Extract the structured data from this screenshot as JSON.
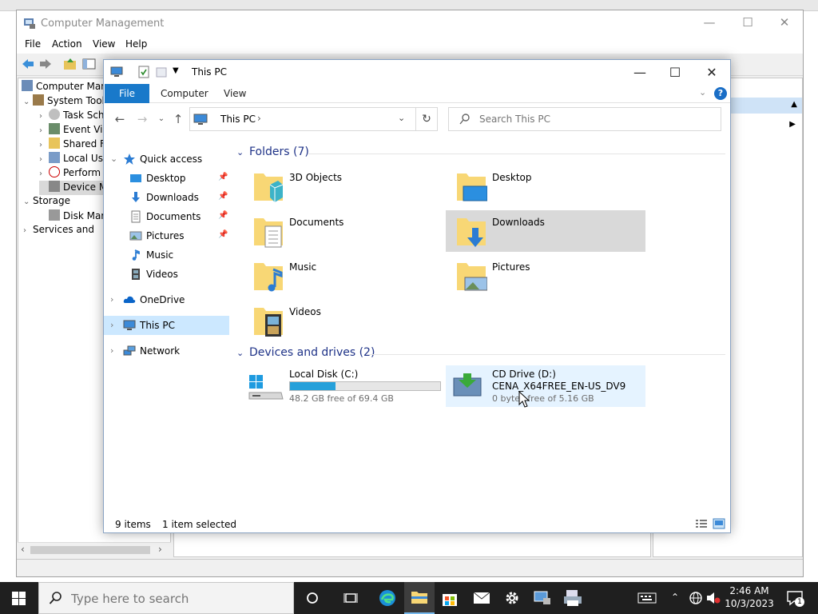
{
  "background_window": {
    "title": "Computer Management",
    "menu": [
      "File",
      "Action",
      "View",
      "Help"
    ],
    "tree": [
      {
        "label": "Computer Manag"
      },
      {
        "label": "System Tool"
      },
      {
        "label": "Task Sch"
      },
      {
        "label": "Event Vie"
      },
      {
        "label": "Shared F"
      },
      {
        "label": "Local Us"
      },
      {
        "label": "Perform"
      },
      {
        "label": "Device M"
      },
      {
        "label": "Storage"
      },
      {
        "label": "Disk Mar"
      },
      {
        "label": "Services and"
      }
    ]
  },
  "explorer": {
    "title": "This PC",
    "ribbon_tabs": {
      "file": "File",
      "computer": "Computer",
      "view": "View"
    },
    "address": {
      "location": "This PC"
    },
    "search": {
      "placeholder": "Search This PC"
    },
    "nav": {
      "quick_access": "Quick access",
      "pinned": [
        "Desktop",
        "Downloads",
        "Documents",
        "Pictures"
      ],
      "unpinned": [
        "Music",
        "Videos"
      ],
      "onedrive": "OneDrive",
      "this_pc": "This PC",
      "network": "Network"
    },
    "folders_header": "Folders (7)",
    "folders": [
      "3D Objects",
      "Desktop",
      "Documents",
      "Downloads",
      "Music",
      "Pictures",
      "Videos"
    ],
    "selected_folder": "Downloads",
    "devices_header": "Devices and drives (2)",
    "drives": {
      "c": {
        "name": "Local Disk (C:)",
        "free_text": "48.2 GB free of 69.4 GB",
        "used_fraction": 0.305
      },
      "d": {
        "name": "CD Drive (D:)",
        "label": "CENA_X64FREE_EN-US_DV9",
        "free_text": "0 bytes free of 5.16 GB"
      }
    },
    "status": {
      "items": "9 items",
      "selected": "1 item selected"
    }
  },
  "taskbar": {
    "search_placeholder": "Type here to search",
    "time": "2:46 AM",
    "date": "10/3/2023",
    "notification_count": "1"
  },
  "colors": {
    "accent": "#1979ca",
    "selection": "#cce8ff",
    "folder": "#f8d775",
    "bar": "#26a0da"
  }
}
